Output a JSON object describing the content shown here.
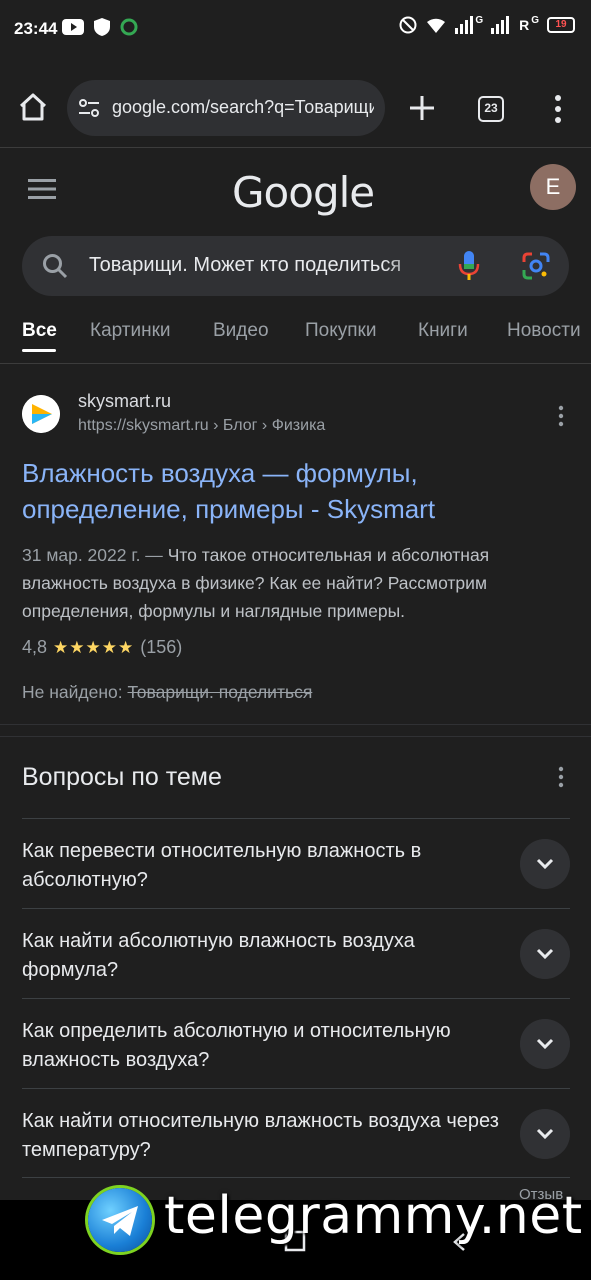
{
  "status_bar": {
    "time": "23:44",
    "network_labels": [
      "G",
      "R",
      "G"
    ],
    "battery": "19"
  },
  "browser": {
    "url": "google.com/search?q=Товарищи",
    "tab_count": "23"
  },
  "google": {
    "logo": "Google",
    "avatar_letter": "E",
    "query": "Товарищи. Может кто поделиться",
    "tabs": [
      {
        "label": "Все",
        "active": true
      },
      {
        "label": "Картинки"
      },
      {
        "label": "Видео"
      },
      {
        "label": "Покупки"
      },
      {
        "label": "Книги"
      },
      {
        "label": "Новости"
      }
    ]
  },
  "result": {
    "site_name": "skysmart.ru",
    "site_url": "https://skysmart.ru › Блог › Физика",
    "title": "Влажность воздуха — формулы, определение, примеры - Skysmart",
    "date": "31 мар. 2022 г. — ",
    "snippet": "Что такое относительная и абсолютная влажность воздуха в физике? Как ее найти? Рассмотрим определения, формулы и наглядные примеры.",
    "rating": "4,8",
    "stars": 5,
    "reviews": "(156)",
    "not_found_label": "Не найдено: ",
    "not_found_terms": "Товарищи. поделиться"
  },
  "paa": {
    "title": "Вопросы по теме",
    "questions": [
      "Как перевести относительную влажность в абсолютную?",
      "Как найти абсолютную влажность воздуха формула?",
      "Как определить абсолютную и относительную влажность воздуха?",
      "Как найти относительную влажность воздуха через температуру?"
    ],
    "feedback": "Отзыв"
  },
  "watermark": "telegrammy.net"
}
